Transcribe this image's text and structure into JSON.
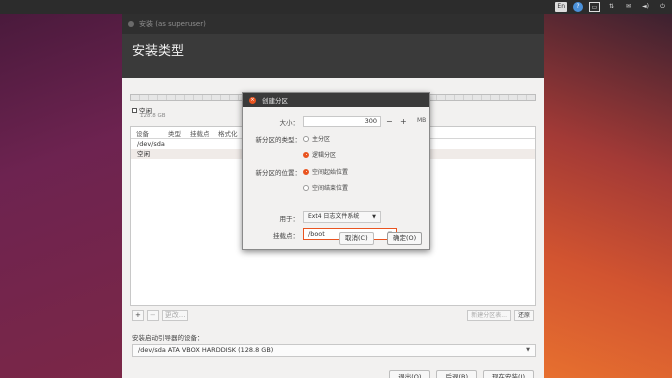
{
  "window": {
    "title": "安装 (as superuser)",
    "header": "安装类型"
  },
  "partitions": {
    "free_label": "空闲",
    "free_size": "128.8 GB",
    "columns": [
      "设备",
      "类型",
      "挂载点",
      "格式化"
    ],
    "rows": [
      "/dev/sda",
      "空闲"
    ],
    "add": "+",
    "remove": "−",
    "change": "更改...",
    "new_table": "新建分区表...",
    "revert": "还原"
  },
  "boot": {
    "label": "安装启动引导器的设备：",
    "device": "/dev/sda ATA VBOX HARDDISK (128.8 GB)"
  },
  "footer": {
    "quit": "退出(Q)",
    "back": "后退(B)",
    "install": "现在安装(I)"
  },
  "dialog": {
    "title": "创建分区",
    "size_label": "大小：",
    "size_value": "300",
    "minus": "−",
    "plus": "+",
    "unit": "MB",
    "type_label": "新分区的类型：",
    "type_primary": "主分区",
    "type_logical": "逻辑分区",
    "loc_label": "新分区的位置：",
    "loc_start": "空间起始位置",
    "loc_end": "空间结束位置",
    "use_label": "用于：",
    "use_value": "Ext4 日志文件系统",
    "mount_label": "挂载点：",
    "mount_value": "/boot",
    "cancel": "取消(C)",
    "ok": "确定(O)"
  },
  "tray": {
    "keyboard": "En",
    "help": "?",
    "battery": "▭",
    "network": "⇅",
    "mail": "✉",
    "volume": "◄)",
    "power": "⏻"
  }
}
